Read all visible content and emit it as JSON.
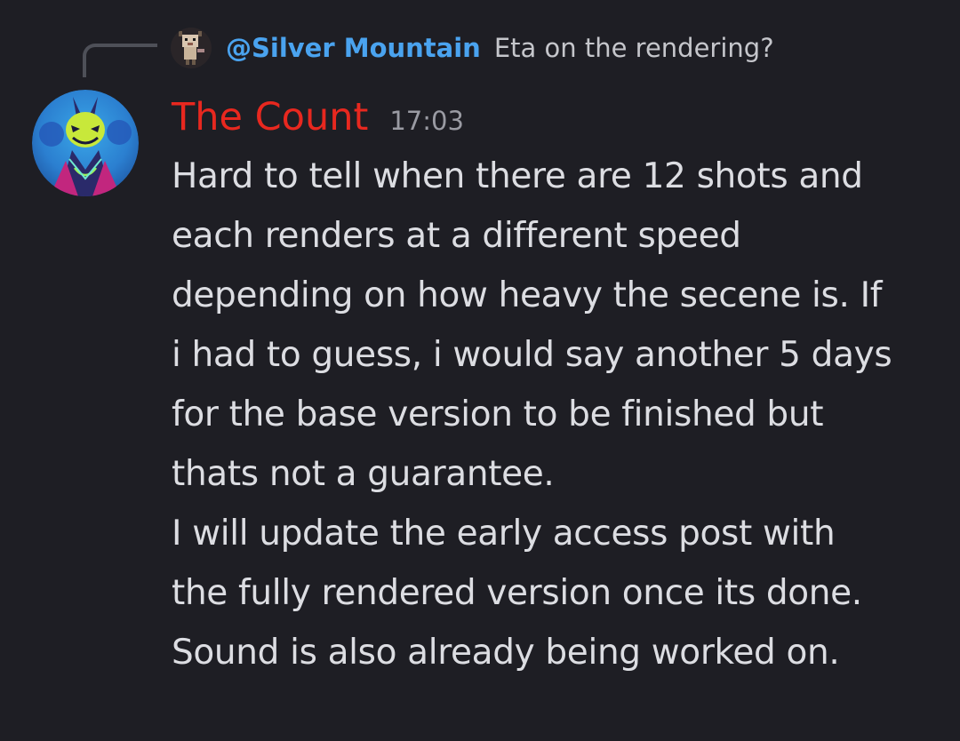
{
  "reply": {
    "avatar_icon": "pixel-deer-avatar-icon",
    "author": "@Silver Mountain",
    "text": "Eta on the rendering?"
  },
  "message": {
    "avatar_icon": "neon-demon-avatar-icon",
    "author": "The Count",
    "author_color": "#e8281f",
    "timestamp": "17:03",
    "lines": [
      "Hard to tell when there are 12 shots and",
      "each renders at a different speed",
      "depending on how heavy the secene is. If",
      "i had to guess, i would say another 5 days",
      "for the base version to be finished but",
      "thats not a guarantee.",
      "I will update the early access post with",
      "the fully rendered version once its done.",
      "Sound is also already being worked on."
    ]
  },
  "colors": {
    "background": "#1e1e24",
    "mention": "#4aa3ef",
    "text": "#dcdde2",
    "timestamp": "#9a9ba3"
  }
}
